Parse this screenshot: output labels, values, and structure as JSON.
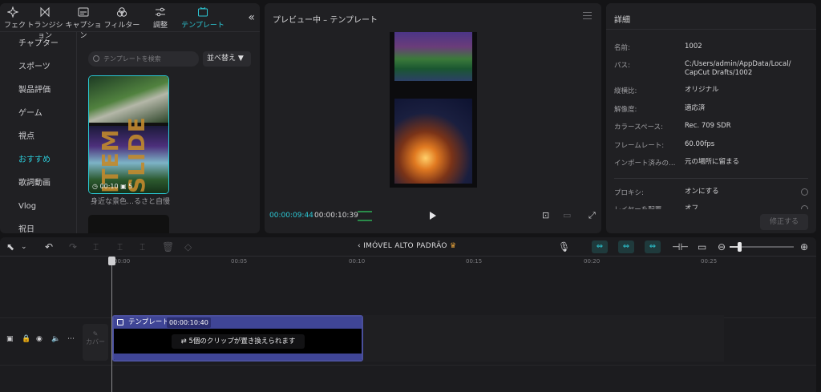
{
  "tabs": [
    {
      "label": "フェクト",
      "icon": "effects-icon"
    },
    {
      "label": "トランジション",
      "icon": "transition-icon"
    },
    {
      "label": "キャプション",
      "icon": "caption-icon"
    },
    {
      "label": "フィルター",
      "icon": "filter-icon"
    },
    {
      "label": "調整",
      "icon": "adjust-icon"
    },
    {
      "label": "テンプレート",
      "icon": "template-icon",
      "active": true
    }
  ],
  "collapse_glyph": "«",
  "categories": [
    "チャプター",
    "スポーツ",
    "製品評価",
    "ゲーム",
    "視点",
    "おすすめ",
    "歌詞動画",
    "Vlog",
    "祝日"
  ],
  "active_category": "おすすめ",
  "search": {
    "placeholder": "テンプレートを検索"
  },
  "sort_label": "並べ替え",
  "template_card": {
    "overlay_text": "ITEM SLIDE",
    "duration": "00:10",
    "clip_count": "5",
    "title": "身近な景色…るさと自慢"
  },
  "preview": {
    "title": "プレビュー中 – テンプレート",
    "current_time": "00:00:09:44",
    "total_time": "00:00:10:39"
  },
  "details": {
    "header": "詳細",
    "rows": [
      {
        "label": "名前:",
        "value": "1002"
      },
      {
        "label": "パス:",
        "value": "C:/Users/admin/AppData/Local/\nCapCut Drafts/1002"
      },
      {
        "label": "縦横比:",
        "value": "オリジナル"
      },
      {
        "label": "解像度:",
        "value": "適応済"
      },
      {
        "label": "カラースペース:",
        "value": "Rec. 709 SDR"
      },
      {
        "label": "フレームレート:",
        "value": "60.00fps"
      },
      {
        "label": "インポート済みの…",
        "value": "元の場所に留まる"
      }
    ],
    "proxy_label": "プロキシ:",
    "proxy_value": "オンにする",
    "layer_label": "レイヤーを配置",
    "layer_value": "オフ",
    "apply_button": "修正する"
  },
  "timeline": {
    "project_title": "IMÓVEL ALTO PADRÃO",
    "ruler": [
      "00:00",
      "00:05",
      "00:10",
      "00:15",
      "00:20",
      "00:25"
    ],
    "cover_label": "カバー",
    "clip": {
      "label": "テンプレート",
      "duration": "00:00:10:40",
      "note": "5個のクリップが置き換えられます"
    }
  },
  "colors": {
    "accent": "#2cc9d6",
    "clip": "#3f4596",
    "highlight_border": "#29c7d3"
  }
}
